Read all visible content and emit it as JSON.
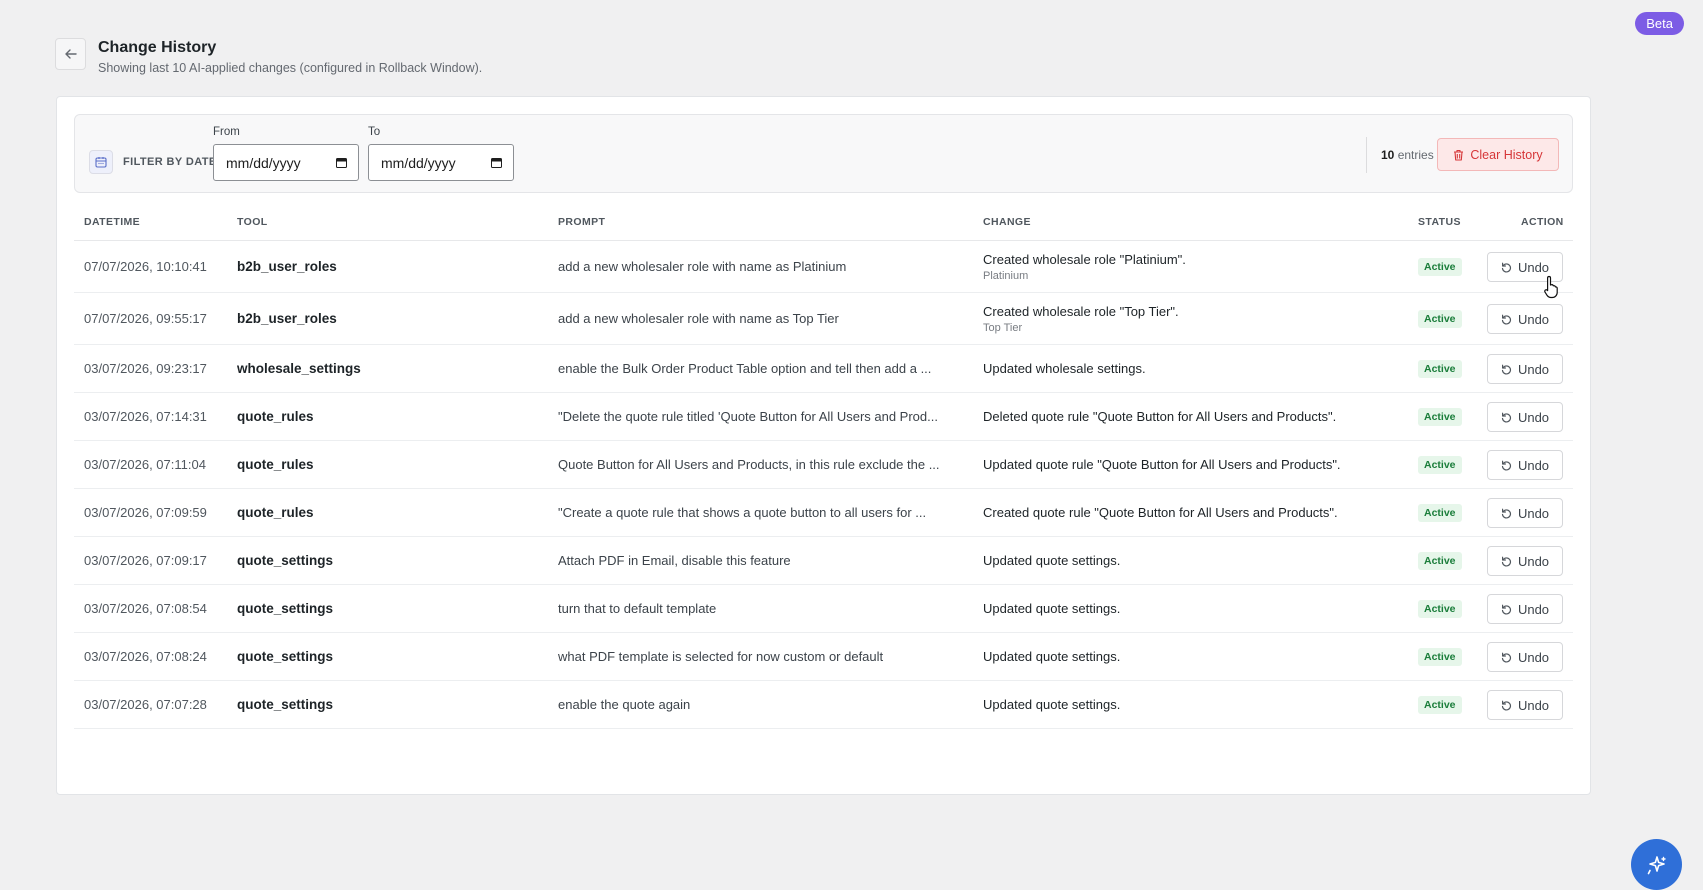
{
  "badge": {
    "beta": "Beta"
  },
  "header": {
    "title": "Change History",
    "subtitle": "Showing last 10 AI-applied changes (configured in Rollback Window)."
  },
  "filter": {
    "label": "FILTER BY DATE",
    "from_label": "From",
    "to_label": "To",
    "from_value": "mm/dd/yyyy",
    "to_value": "mm/dd/yyyy",
    "entries_count": "10",
    "entries_label": "entries",
    "clear_label": "Clear History"
  },
  "table": {
    "columns": [
      "DATETIME",
      "TOOL",
      "PROMPT",
      "CHANGE",
      "STATUS",
      "ACTION"
    ],
    "rows": [
      {
        "datetime": "07/07/2026, 10:10:41",
        "tool": "b2b_user_roles",
        "prompt": "add a new wholesaler role with name as Platinium",
        "change": "Created wholesale role \"Platinium\".",
        "change_sub": "Platinium",
        "status": "Active",
        "action": "Undo"
      },
      {
        "datetime": "07/07/2026, 09:55:17",
        "tool": "b2b_user_roles",
        "prompt": "add a new wholesaler role with name as Top Tier",
        "change": "Created wholesale role \"Top Tier\".",
        "change_sub": "Top Tier",
        "status": "Active",
        "action": "Undo"
      },
      {
        "datetime": "03/07/2026, 09:23:17",
        "tool": "wholesale_settings",
        "prompt": "enable the Bulk Order Product Table option and tell then add a ...",
        "change": "Updated wholesale settings.",
        "change_sub": "",
        "status": "Active",
        "action": "Undo"
      },
      {
        "datetime": "03/07/2026, 07:14:31",
        "tool": "quote_rules",
        "prompt": "\"Delete the quote rule titled 'Quote Button for All Users and Prod...",
        "change": "Deleted quote rule \"Quote Button for All Users and Products\".",
        "change_sub": "",
        "status": "Active",
        "action": "Undo"
      },
      {
        "datetime": "03/07/2026, 07:11:04",
        "tool": "quote_rules",
        "prompt": "Quote Button for All Users and Products, in this rule exclude the ...",
        "change": "Updated quote rule \"Quote Button for All Users and Products\".",
        "change_sub": "",
        "status": "Active",
        "action": "Undo"
      },
      {
        "datetime": "03/07/2026, 07:09:59",
        "tool": "quote_rules",
        "prompt": "\"Create a quote rule that shows a quote button to all users for ...",
        "change": "Created quote rule \"Quote Button for All Users and Products\".",
        "change_sub": "",
        "status": "Active",
        "action": "Undo"
      },
      {
        "datetime": "03/07/2026, 07:09:17",
        "tool": "quote_settings",
        "prompt": "Attach PDF in Email, disable this feature",
        "change": "Updated quote settings.",
        "change_sub": "",
        "status": "Active",
        "action": "Undo"
      },
      {
        "datetime": "03/07/2026, 07:08:54",
        "tool": "quote_settings",
        "prompt": "turn that to default template",
        "change": "Updated quote settings.",
        "change_sub": "",
        "status": "Active",
        "action": "Undo"
      },
      {
        "datetime": "03/07/2026, 07:08:24",
        "tool": "quote_settings",
        "prompt": "what PDF template is selected for now custom or default",
        "change": "Updated quote settings.",
        "change_sub": "",
        "status": "Active",
        "action": "Undo"
      },
      {
        "datetime": "03/07/2026, 07:07:28",
        "tool": "quote_settings",
        "prompt": "enable the quote again",
        "change": "Updated quote settings.",
        "change_sub": "",
        "status": "Active",
        "action": "Undo"
      }
    ]
  },
  "icons": {
    "back": "arrow-left-icon",
    "calendar": "calendar-icon",
    "trash": "trash-icon",
    "undo": "undo-icon",
    "assistant": "sparkle-icon"
  },
  "colors": {
    "beta": "#7c5ce5",
    "danger": "#d63638",
    "active_badge_bg": "#e6f6ea",
    "active_badge_text": "#1a7d3a",
    "fab": "#2f6fd8"
  }
}
